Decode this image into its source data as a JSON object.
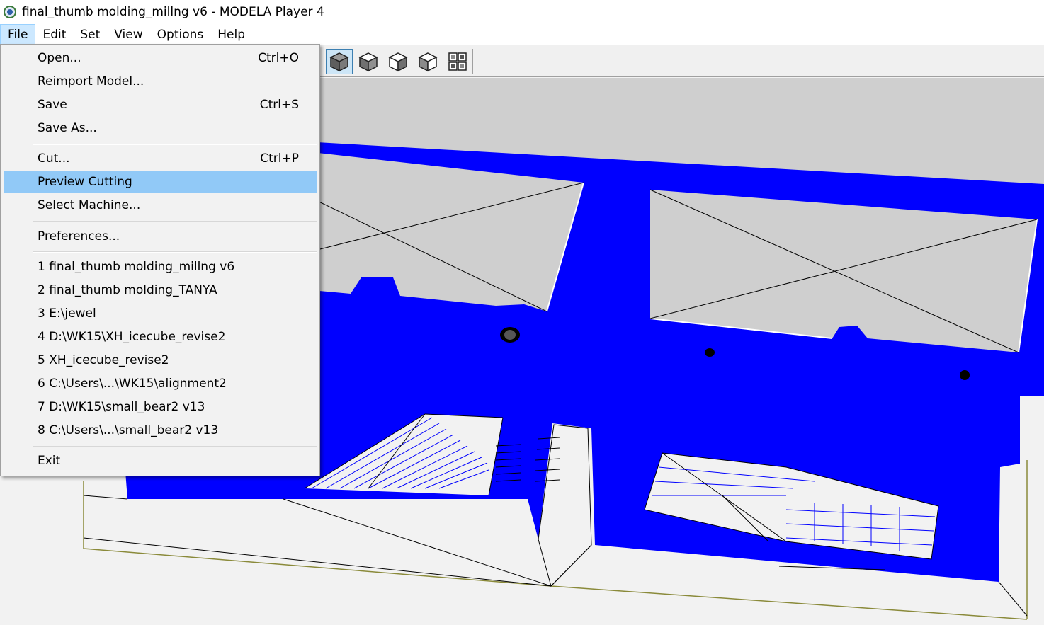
{
  "window": {
    "title": "final_thumb molding_millng v6 - MODELA Player 4",
    "app_icon": "modela-player-icon"
  },
  "menubar": {
    "items": [
      {
        "label": "File",
        "active": true
      },
      {
        "label": "Edit"
      },
      {
        "label": "Set"
      },
      {
        "label": "View"
      },
      {
        "label": "Options"
      },
      {
        "label": "Help"
      }
    ]
  },
  "toolbar": {
    "view_buttons": [
      {
        "icon": "cube-iso-view-icon",
        "pressed": true
      },
      {
        "icon": "cube-left-view-icon"
      },
      {
        "icon": "cube-right-view-icon"
      },
      {
        "icon": "cube-back-view-icon"
      },
      {
        "icon": "four-views-icon"
      }
    ]
  },
  "file_menu": {
    "items": [
      {
        "label": "Open...",
        "shortcut": "Ctrl+O"
      },
      {
        "label": "Reimport Model...",
        "shortcut": ""
      },
      {
        "label": "Save",
        "shortcut": "Ctrl+S"
      },
      {
        "label": "Save As...",
        "shortcut": ""
      },
      {
        "label": "Cut...",
        "shortcut": "Ctrl+P"
      },
      {
        "label": "Preview Cutting",
        "shortcut": "",
        "highlighted": true
      },
      {
        "label": "Select Machine...",
        "shortcut": ""
      },
      {
        "label": "Preferences...",
        "shortcut": ""
      },
      {
        "label": "1 final_thumb molding_millng v6",
        "shortcut": ""
      },
      {
        "label": "2 final_thumb molding_TANYA",
        "shortcut": ""
      },
      {
        "label": "3 E:\\jewel",
        "shortcut": ""
      },
      {
        "label": "4 D:\\WK15\\XH_icecube_revise2",
        "shortcut": ""
      },
      {
        "label": "5 XH_icecube_revise2",
        "shortcut": ""
      },
      {
        "label": "6 C:\\Users\\...\\WK15\\alignment2",
        "shortcut": ""
      },
      {
        "label": "7 D:\\WK15\\small_bear2 v13",
        "shortcut": ""
      },
      {
        "label": "8 C:\\Users\\...\\small_bear2 v13",
        "shortcut": ""
      },
      {
        "label": "Exit",
        "shortcut": ""
      }
    ]
  },
  "viewport": {
    "toolpath_color": "#0000ff",
    "background_color": "#f2f2f2",
    "pocket_color": "#cfcfcf",
    "stock_outline_color": "#8a8a3a"
  }
}
